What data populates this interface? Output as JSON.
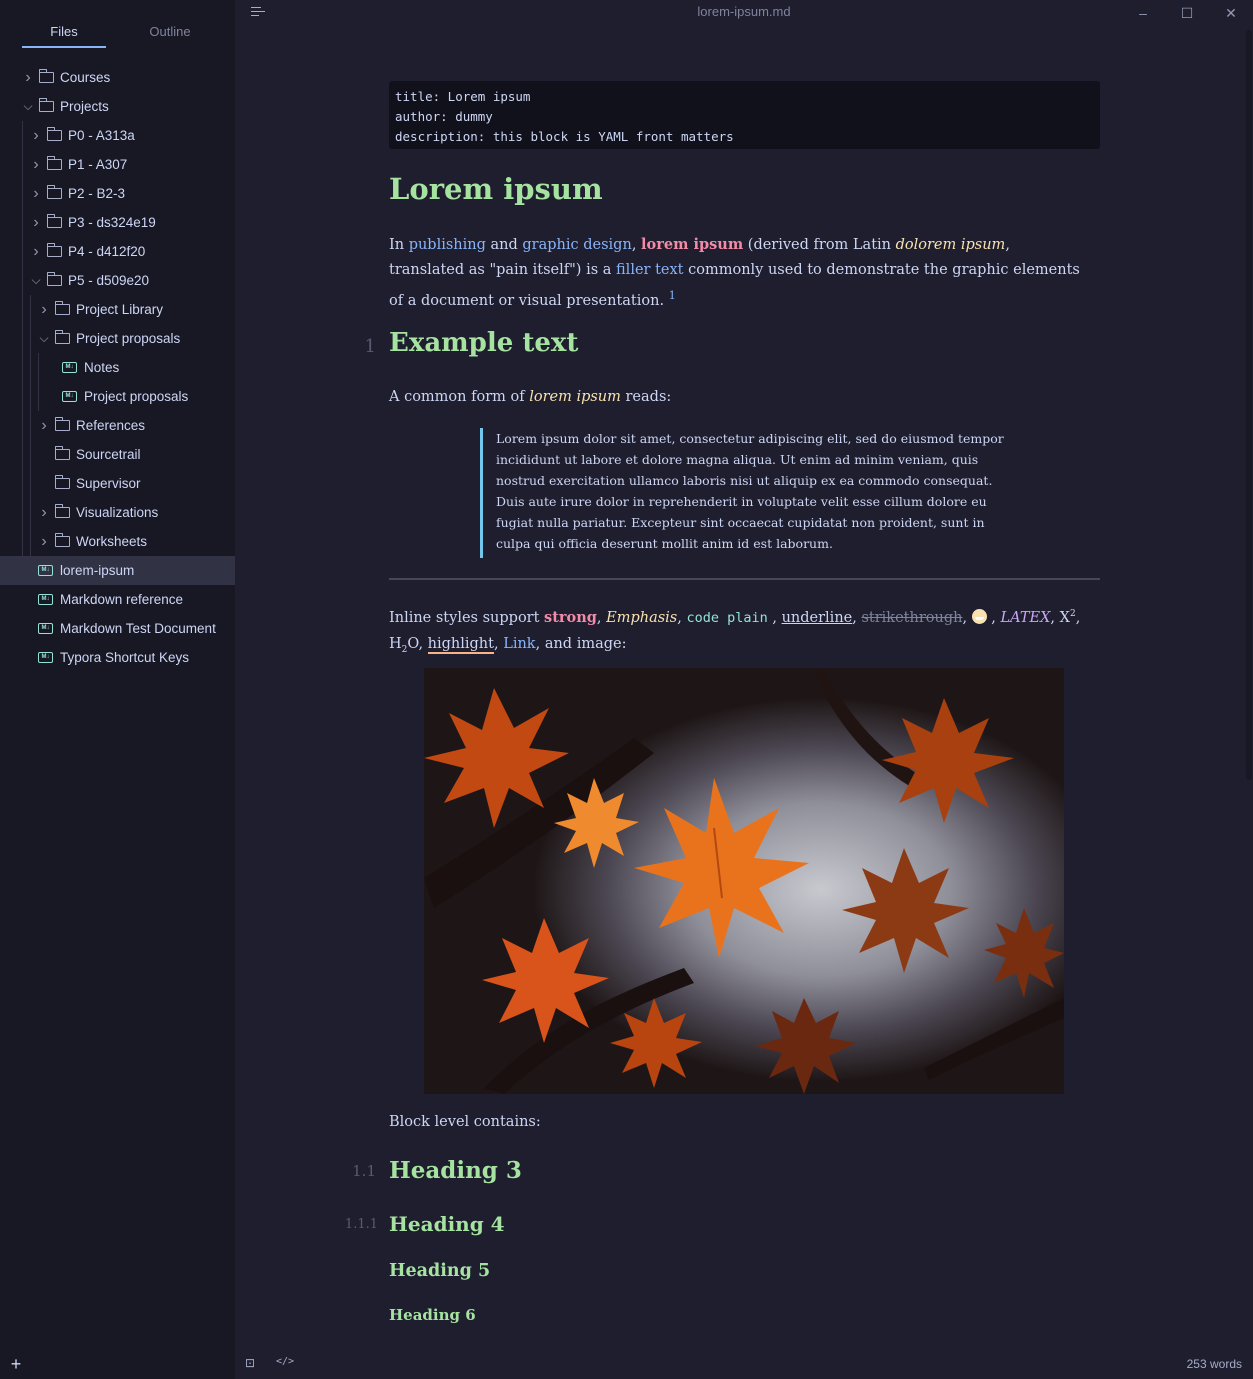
{
  "window": {
    "title": "lorem-ipsum.md",
    "minimize": "–",
    "maximize": "☐",
    "close": "✕"
  },
  "sidebar": {
    "tabs": {
      "files": "Files",
      "outline": "Outline"
    },
    "items": [
      {
        "label": "Courses",
        "type": "folder",
        "depth": 0,
        "expanded": false
      },
      {
        "label": "Projects",
        "type": "folder",
        "depth": 0,
        "expanded": true
      },
      {
        "label": "P0 - A313a",
        "type": "folder",
        "depth": 1,
        "expanded": false
      },
      {
        "label": "P1 - A307",
        "type": "folder",
        "depth": 1,
        "expanded": false
      },
      {
        "label": "P2 - B2-3",
        "type": "folder",
        "depth": 1,
        "expanded": false
      },
      {
        "label": "P3 - ds324e19",
        "type": "folder",
        "depth": 1,
        "expanded": false
      },
      {
        "label": "P4 - d412f20",
        "type": "folder",
        "depth": 1,
        "expanded": false
      },
      {
        "label": "P5 - d509e20",
        "type": "folder",
        "depth": 1,
        "expanded": true
      },
      {
        "label": "Project Library",
        "type": "folder",
        "depth": 2,
        "expanded": false
      },
      {
        "label": "Project proposals",
        "type": "folder",
        "depth": 2,
        "expanded": true
      },
      {
        "label": "Notes",
        "type": "file",
        "depth": 3
      },
      {
        "label": "Project proposals",
        "type": "file",
        "depth": 3
      },
      {
        "label": "References",
        "type": "folder",
        "depth": 2,
        "expanded": false
      },
      {
        "label": "Sourcetrail",
        "type": "folder",
        "depth": 2,
        "leaf": true
      },
      {
        "label": "Supervisor",
        "type": "folder",
        "depth": 2,
        "leaf": true
      },
      {
        "label": "Visualizations",
        "type": "folder",
        "depth": 2,
        "expanded": false
      },
      {
        "label": "Worksheets",
        "type": "folder",
        "depth": 2,
        "expanded": false
      },
      {
        "label": "lorem-ipsum",
        "type": "file",
        "depth": 0,
        "active": true
      },
      {
        "label": "Markdown reference",
        "type": "file",
        "depth": 0
      },
      {
        "label": "Markdown Test Document",
        "type": "file",
        "depth": 0
      },
      {
        "label": "Typora Shortcut Keys",
        "type": "file",
        "depth": 0
      }
    ],
    "add_label": "+"
  },
  "doc": {
    "yaml": [
      "title: Lorem ipsum",
      "author: dummy",
      "description: this block is YAML front matters"
    ],
    "h1": "Lorem ipsum",
    "intro": {
      "in": "In ",
      "publishing": "publishing",
      "and": " and ",
      "graphic_design": "graphic design",
      "comma1": ", ",
      "lorem_ipsum": "lorem ipsum",
      "derived": " (derived from Latin ",
      "dolorem": "dolorem ipsum",
      "translated": ", translated as \"pain itself\") is a ",
      "filler": "filler text",
      "rest": " commonly used to demonstrate the graphic elements of a document or visual presentation. ",
      "footnote": "1"
    },
    "h2_num": "1",
    "h2": "Example text",
    "common_form": {
      "a": "A common form of ",
      "em": "lorem ipsum",
      "b": " reads:"
    },
    "quote": "Lorem ipsum dolor sit amet, consectetur adipiscing elit, sed do eiusmod tempor incididunt ut labore et dolore magna aliqua. Ut enim ad minim veniam, quis nostrud exercitation ullamco laboris nisi ut aliquip ex ea commodo consequat. Duis aute irure dolor in reprehenderit in voluptate velit esse cillum dolore eu fugiat nulla pariatur. Excepteur sint occaecat cupidatat non proident, sunt in culpa qui officia deserunt mollit anim id est laborum.",
    "inline": {
      "prefix": "Inline styles support ",
      "strong": "strong",
      "emphasis": "Emphasis",
      "code": "code plain",
      "underline": "underline",
      "strike": "strikethrough",
      "latex": "LATEX",
      "x": "X",
      "two": "2",
      "h": "H",
      "o": "O",
      "highlight": "highlight",
      "link": "Link",
      "suffix": ", and image:"
    },
    "block_level": "Block level contains:",
    "h3_num": "1.1",
    "h3": "Heading 3",
    "h4_num": "1.1.1",
    "h4": "Heading 4",
    "h5": "Heading 5",
    "h6": "Heading 6"
  },
  "footer": {
    "words": "253 words",
    "sidebar_toggle": "⊡",
    "source_toggle": "</>"
  },
  "colors": {
    "background": "#1e1e2e",
    "sidebar": "#181825",
    "heading": "#a6e3a1",
    "link": "#89b4fa",
    "strong": "#f38ba8",
    "emphasis": "#f9e2af",
    "quote_border": "#74c7ec"
  }
}
